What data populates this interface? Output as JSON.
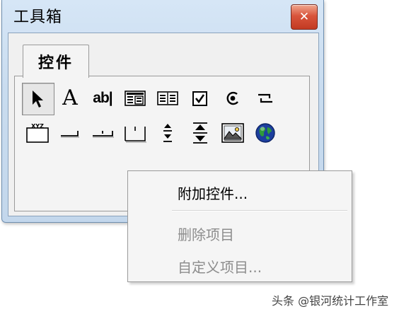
{
  "window": {
    "title": "工具箱",
    "close_glyph": "✕"
  },
  "tabs": [
    {
      "label": "控件"
    }
  ],
  "toolbox": {
    "rows": [
      [
        "pointer-icon",
        "label-icon",
        "textbox-icon",
        "frame-icon",
        "command-button-icon",
        "checkbox-icon",
        "option-button-icon",
        "toggle-icon"
      ],
      [
        "tab-strip-icon",
        "combo-box-icon",
        "list-box-icon",
        "multi-page-icon",
        "spin-button-icon",
        "scroll-bar-icon",
        "image-icon",
        "globe-icon"
      ]
    ],
    "label_glyph": "A",
    "textbox_glyph": "ab|",
    "tabstrip_glyph": "XYZ"
  },
  "context_menu": {
    "items": [
      {
        "label": "附加控件...",
        "enabled": true
      },
      {
        "label": "删除项目",
        "enabled": false
      },
      {
        "label": "自定义项目...",
        "enabled": false
      }
    ]
  },
  "watermark": {
    "text": "头条 @银河统计工作室"
  },
  "colors": {
    "title_gradient_top": "#d6e6f6",
    "close_red": "#c23a22",
    "disabled_text": "#8d8d8d"
  }
}
